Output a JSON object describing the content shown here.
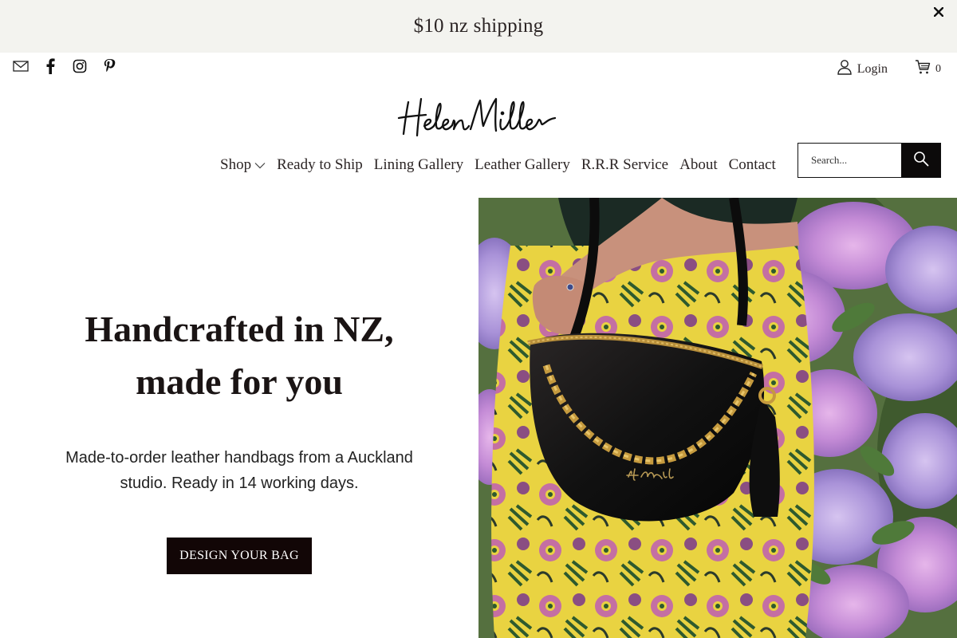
{
  "announcement": {
    "text": "$10 nz shipping",
    "close_icon": "close-icon"
  },
  "social": [
    {
      "name": "email-icon"
    },
    {
      "name": "facebook-icon"
    },
    {
      "name": "instagram-icon"
    },
    {
      "name": "pinterest-icon"
    }
  ],
  "header": {
    "login_label": "Login",
    "cart_count": "0",
    "logo_text": "HelenMiller"
  },
  "nav": {
    "items": [
      {
        "label": "Shop",
        "has_dropdown": true
      },
      {
        "label": "Ready to Ship"
      },
      {
        "label": "Lining Gallery"
      },
      {
        "label": "Leather Gallery"
      },
      {
        "label": "R.R.R Service"
      },
      {
        "label": "About"
      },
      {
        "label": "Contact"
      }
    ]
  },
  "search": {
    "placeholder": "Search..."
  },
  "hero": {
    "title_line1": "Handcrafted in NZ,",
    "title_line2": "made for you",
    "subtitle_line1": "Made-to-order leather handbags from a Auckland",
    "subtitle_line2": "studio. Ready in 14 working days.",
    "cta_label": "DESIGN YOUR BAG",
    "bag_signature": "HelenMiller"
  },
  "colors": {
    "announce_bg": "#f3f3ef",
    "cta_bg": "#120606",
    "text": "#1a1414"
  }
}
